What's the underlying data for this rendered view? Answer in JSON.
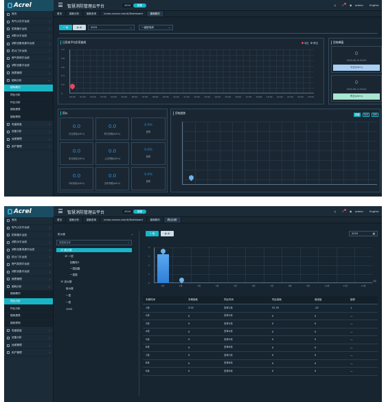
{
  "app": {
    "logo": "Acrel",
    "title": "智慧消防管理云平台",
    "pill_num": "4324",
    "pill_label": "报警",
    "user": "admin",
    "lang": "English"
  },
  "nav": [
    {
      "label": "首页"
    },
    {
      "label": "电气火灾平台统"
    },
    {
      "label": "防排烟平台统"
    },
    {
      "label": "消防水平台统"
    },
    {
      "label": "消防设备电源平台统"
    },
    {
      "label": "防火门平台统"
    },
    {
      "label": "燃气探测平台统"
    },
    {
      "label": "消防设备平台统"
    },
    {
      "label": "报表管理"
    },
    {
      "label": "能耗分析"
    }
  ],
  "nav_sub": [
    {
      "label": "能耗概况"
    },
    {
      "label": "同比分析"
    },
    {
      "label": "环比分析"
    },
    {
      "label": "能耗报表"
    },
    {
      "label": "能耗预测"
    }
  ],
  "nav_bottom": [
    {
      "label": "电量能量"
    },
    {
      "label": "设备分析"
    },
    {
      "label": "运维管理"
    },
    {
      "label": "用户管理"
    }
  ],
  "tabs1": [
    "首页",
    "能耗分析",
    "能耗查询",
    "/cross.xxxxxx.com/#/Dashboard",
    "能耗概况"
  ],
  "tabs2": [
    "首页",
    "能耗分析",
    "能耗查询",
    "/cross.xxxxxx.com/#/Dashboard",
    "能耗概况",
    "同比分析"
  ],
  "s1": {
    "btn_elec": "电",
    "btn_water": "水",
    "select_id": "4324",
    "select_period": "一级配电房",
    "chart_title": "日用电平均负荷曲线",
    "legend_a": "今日",
    "legend_b": "昨日",
    "x_ticks": [
      "00:00",
      "01:00",
      "02:00",
      "03:00",
      "04:00",
      "05:00",
      "06:00",
      "07:00",
      "08:00",
      "09:00",
      "10:00",
      "11:00",
      "12:00",
      "13:00",
      "14:00",
      "15:00",
      "16:00",
      "17:00",
      "18:00",
      "19:00",
      "20:00",
      "21:00",
      "22:00",
      "23:00"
    ],
    "y_ticks": [
      "1.0",
      "0.8",
      "0.6",
      "0.4",
      "0.2",
      "0"
    ],
    "side_title": "用电峰值",
    "peak1_value": "0",
    "peak1_date": "2020-06-10 00:00",
    "peak1_btn": "今日(kW·h)",
    "peak2_value": "0",
    "peak2_date": "2020-06-11 00:00",
    "peak2_btn": "昨日(kW·h)",
    "stats_title": "用以",
    "stats": [
      {
        "v": "0.0",
        "l": "今日用电(kW·h)"
      },
      {
        "v": "0.0",
        "l": "昨日同期(kW·h)"
      },
      {
        "v": "0.0%",
        "l": "趋势"
      },
      {
        "v": "0.0",
        "l": "本月用电(kW·h)"
      },
      {
        "v": "0.0",
        "l": "上月同期(kW·h)"
      },
      {
        "v": "0.0%",
        "l": "趋势"
      },
      {
        "v": "0.0",
        "l": "今年用电(kW·h)"
      },
      {
        "v": "0.0",
        "l": "去年同期(kW·h)"
      },
      {
        "v": "0.0%",
        "l": "趋势"
      }
    ],
    "trend_title": "用电趋势",
    "trend_btns": [
      "本周",
      "本月",
      "本年"
    ]
  },
  "s2": {
    "tree_title": "防火墙",
    "tree_search": "请搜索名称",
    "tree": [
      {
        "label": "1F-新大楼",
        "on": true
      },
      {
        "label": "1F-一层",
        "on": false
      },
      {
        "label": "回路电3",
        "on": false
      },
      {
        "label": "一层回路",
        "on": false
      },
      {
        "label": "一层楼",
        "on": false
      },
      {
        "label": "1F-旧大楼",
        "on": false
      },
      {
        "label": "新大楼",
        "on": false
      },
      {
        "label": "一层",
        "on": false
      },
      {
        "label": "一层",
        "on": false
      },
      {
        "label": "1003",
        "on": false
      }
    ],
    "btn_elec": "电",
    "btn_water": "水",
    "year": "2020",
    "x_unit": "(月)",
    "chart_data": {
      "type": "bar",
      "categories": [
        "1月",
        "2月",
        "3月",
        "4月",
        "5月",
        "6月",
        "7月",
        "8月",
        "9月",
        "10月",
        "11月",
        "12月"
      ],
      "series": [
        {
          "values": [
            3.22,
            0,
            0,
            0,
            0,
            0,
            0,
            0,
            0,
            0,
            0,
            0
          ]
        }
      ],
      "y_ticks": [
        "4",
        "3",
        "2",
        "1",
        "0"
      ],
      "ylim": [
        0,
        4
      ]
    },
    "table": {
      "headers": [
        "本期时间",
        "本期能耗",
        "同比时间",
        "同比能耗",
        "增减量",
        "趋势"
      ],
      "rows": [
        [
          "1月",
          "3.22",
          "去年1月",
          "31.33",
          "-12",
          "↓"
        ],
        [
          "2月",
          "0",
          "去年2月",
          "0",
          "0",
          "—"
        ],
        [
          "3月",
          "0",
          "去年3月",
          "0",
          "0",
          "—"
        ],
        [
          "4月",
          "0",
          "去年4月",
          "0",
          "0",
          "—"
        ],
        [
          "5月",
          "0",
          "去年5月",
          "0",
          "0",
          "—"
        ],
        [
          "6月",
          "0",
          "去年6月",
          "0",
          "0",
          "—"
        ],
        [
          "7月",
          "0",
          "去年7月",
          "0",
          "0",
          "—"
        ],
        [
          "8月",
          "0",
          "去年8月",
          "0",
          "0",
          "—"
        ],
        [
          "9月",
          "0",
          "去年9月",
          "0",
          "0",
          "—"
        ]
      ]
    }
  },
  "colors": {
    "accent": "#19b5c9",
    "bg": "#172531",
    "bar": "#2e7fd6",
    "series_a": "#e5485a",
    "series_b": "#6c8597"
  }
}
